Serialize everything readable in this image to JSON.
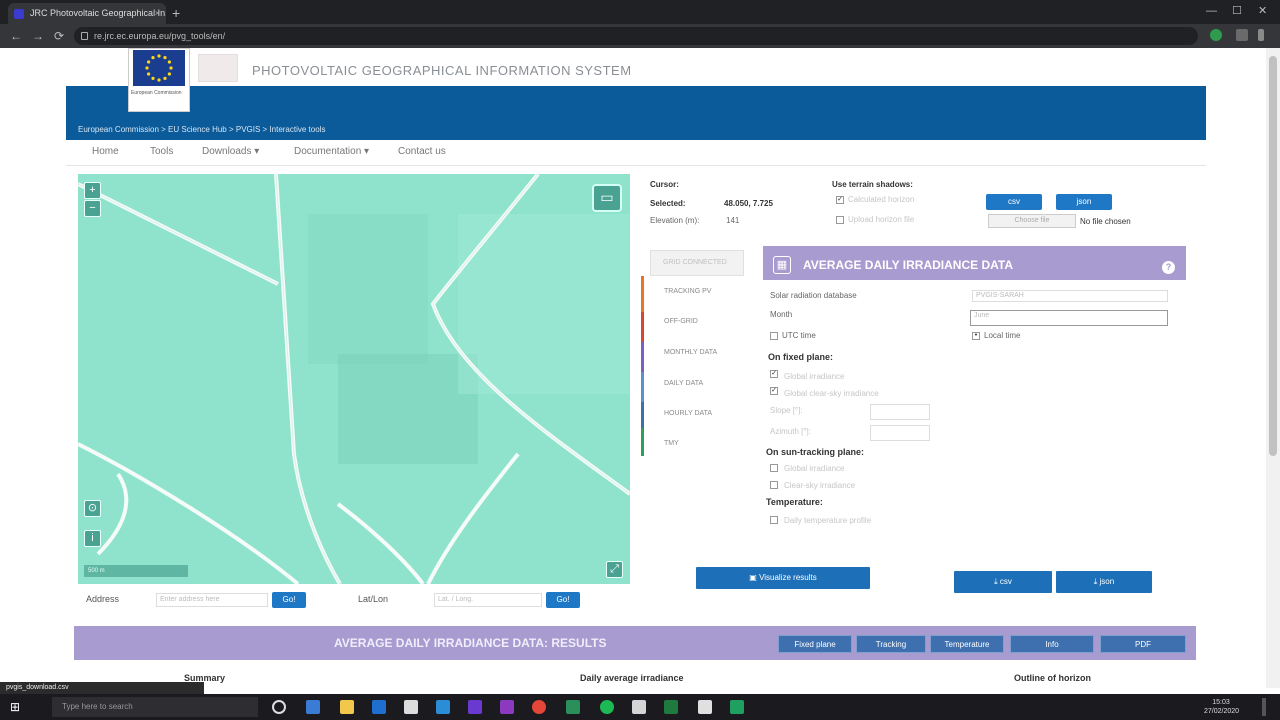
{
  "browser": {
    "tab_title": "JRC Photovoltaic Geographical In...",
    "tab_close": "×",
    "new_tab": "+",
    "address": "re.jrc.ec.europa.eu/pvg_tools/en/",
    "back": "←",
    "forward": "→",
    "reload": "⟳",
    "minimize": "—",
    "maximize": "☐",
    "close": "✕"
  },
  "header": {
    "logo_text": "European Commission",
    "site_title": "PHOTOVOLTAIC GEOGRAPHICAL INFORMATION SYSTEM",
    "breadcrumb": "European Commission > EU Science Hub > PVGIS > Interactive tools"
  },
  "nav": {
    "items": [
      "Home",
      "Tools",
      "Downloads ▾",
      "Documentation ▾",
      "Contact us"
    ]
  },
  "map": {
    "zoom_in": "+",
    "zoom_out": "−",
    "locate": "⊙",
    "info": "i",
    "layers": "▭",
    "scale": "500 m",
    "addr_label": "Address",
    "addr_placeholder": "Enter address here",
    "go": "Go!",
    "latlon_label": "Lat/Lon",
    "latlon_placeholder": "Lat. / Long.",
    "latlon_go": "Go!"
  },
  "coords": {
    "cursor_label": "Cursor:",
    "selected_label": "Selected:",
    "selected_value": "48.050, 7.725",
    "elevation_label": "Elevation (m):",
    "elevation_value": "141"
  },
  "terrain": {
    "label": "Use terrain shadows:",
    "calculated": "Calculated horizon",
    "upload": "Upload horizon file",
    "csv": "csv",
    "json": "json",
    "choose_file": "Choose file",
    "no_file": "No file chosen"
  },
  "tabs": {
    "active": "GRID CONNECTED",
    "items": [
      "TRACKING PV",
      "OFF-GRID",
      "MONTHLY DATA",
      "DAILY DATA",
      "HOURLY DATA",
      "TMY"
    ]
  },
  "panel": {
    "title": "AVERAGE DAILY IRRADIANCE DATA",
    "help": "?",
    "solar_db_label": "Solar radiation database",
    "solar_db_value": "PVGIS-SARAH",
    "month_label": "Month",
    "month_value": "June",
    "utc_label": "UTC time",
    "local_label": "Local time",
    "fixed_plane": "On fixed plane:",
    "global": "Global irradiance",
    "clear_sky": "Global clear-sky irradiance",
    "slope": "Slope [°]:",
    "azimuth": "Azimuth [°]:",
    "two_axis": "On sun-tracking plane:",
    "two_axis_global": "Global irradiance",
    "two_axis_clear": "Clear-sky irradiance",
    "temperature": "Temperature:",
    "daily_temp": "Daily temperature profile",
    "visualize": "Visualize results",
    "csv_btn": "csv",
    "json_btn": "json"
  },
  "results": {
    "title": "AVERAGE DAILY IRRADIANCE DATA: RESULTS",
    "buttons": [
      "Fixed plane",
      "Tracking",
      "Temperature",
      "Info",
      "PDF"
    ],
    "sub_summary": "Summary",
    "sub_daily": "Daily average irradiance",
    "sub_horizon": "Outline of horizon"
  },
  "taskbar": {
    "search": "Type here to search",
    "time": "15:03",
    "date": "27/02/2020"
  },
  "download": "pvgis_download.csv"
}
